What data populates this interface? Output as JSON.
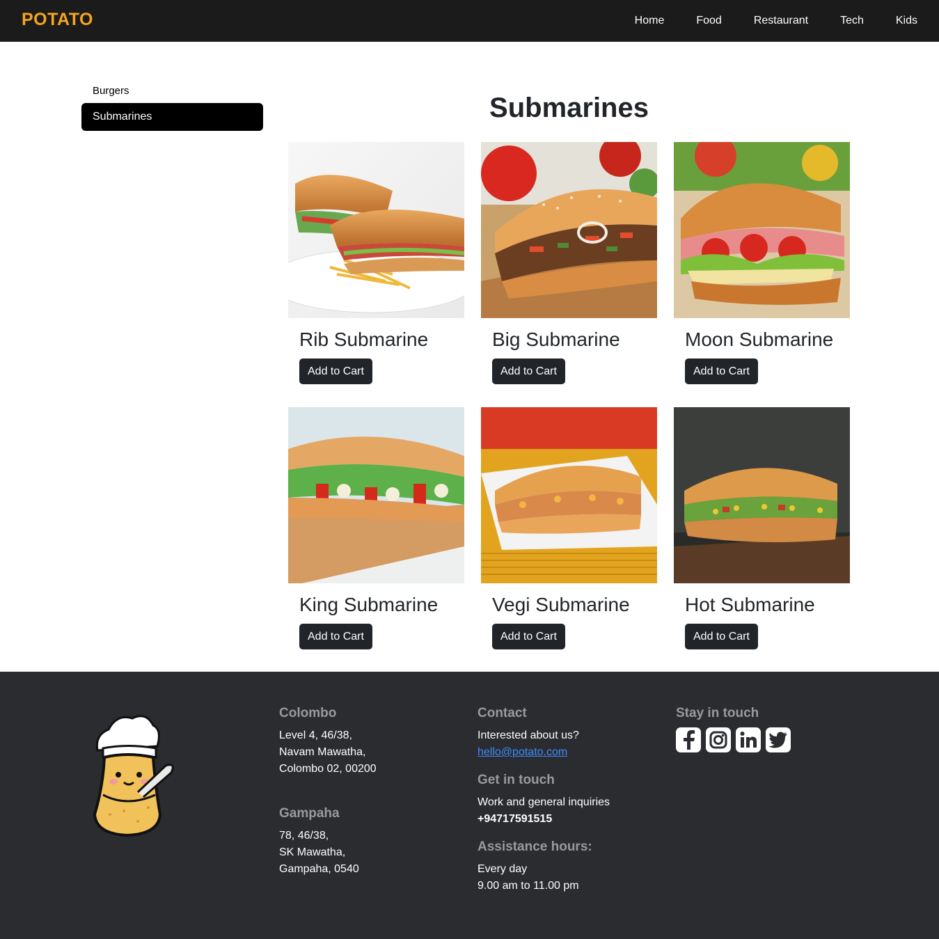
{
  "navbar": {
    "brand": "POTATO",
    "links": [
      "Home",
      "Food",
      "Restaurant",
      "Tech",
      "Kids"
    ]
  },
  "sidebar": {
    "items": [
      {
        "label": "Burgers",
        "active": false
      },
      {
        "label": "Submarines",
        "active": true
      }
    ]
  },
  "main": {
    "title": "Submarines",
    "products": [
      {
        "name": "Rib Submarine",
        "button": "Add to Cart"
      },
      {
        "name": "Big Submarine",
        "button": "Add to Cart"
      },
      {
        "name": "Moon Submarine",
        "button": "Add to Cart"
      },
      {
        "name": "King Submarine",
        "button": "Add to Cart"
      },
      {
        "name": "Vegi Submarine",
        "button": "Add to Cart"
      },
      {
        "name": "Hot Submarine",
        "button": "Add to Cart"
      }
    ]
  },
  "footer": {
    "colombo": {
      "heading": "Colombo",
      "line1": "Level 4, 46/38,",
      "line2": "Navam Mawatha,",
      "line3": "Colombo 02, 00200"
    },
    "gampaha": {
      "heading": "Gampaha",
      "line1": "78, 46/38,",
      "line2": "SK Mawatha,",
      "line3": "Gampaha, 0540"
    },
    "contact": {
      "heading": "Contact",
      "text": "Interested about us?",
      "email": "hello@potato.com"
    },
    "get_in_touch": {
      "heading": "Get in touch",
      "text": "Work and general inquiries",
      "phone": "+94717591515"
    },
    "hours": {
      "heading": "Assistance hours:",
      "line1": "Every day",
      "line2": "9.00 am to 11.00 pm"
    },
    "social": {
      "heading": "Stay in touch",
      "icons": [
        "facebook-icon",
        "instagram-icon",
        "linkedin-icon",
        "twitter-icon"
      ]
    }
  },
  "colors": {
    "brand": "#f7a51c",
    "navbar": "#1b1b1b",
    "footer": "#2b2c30",
    "button": "#212529"
  }
}
